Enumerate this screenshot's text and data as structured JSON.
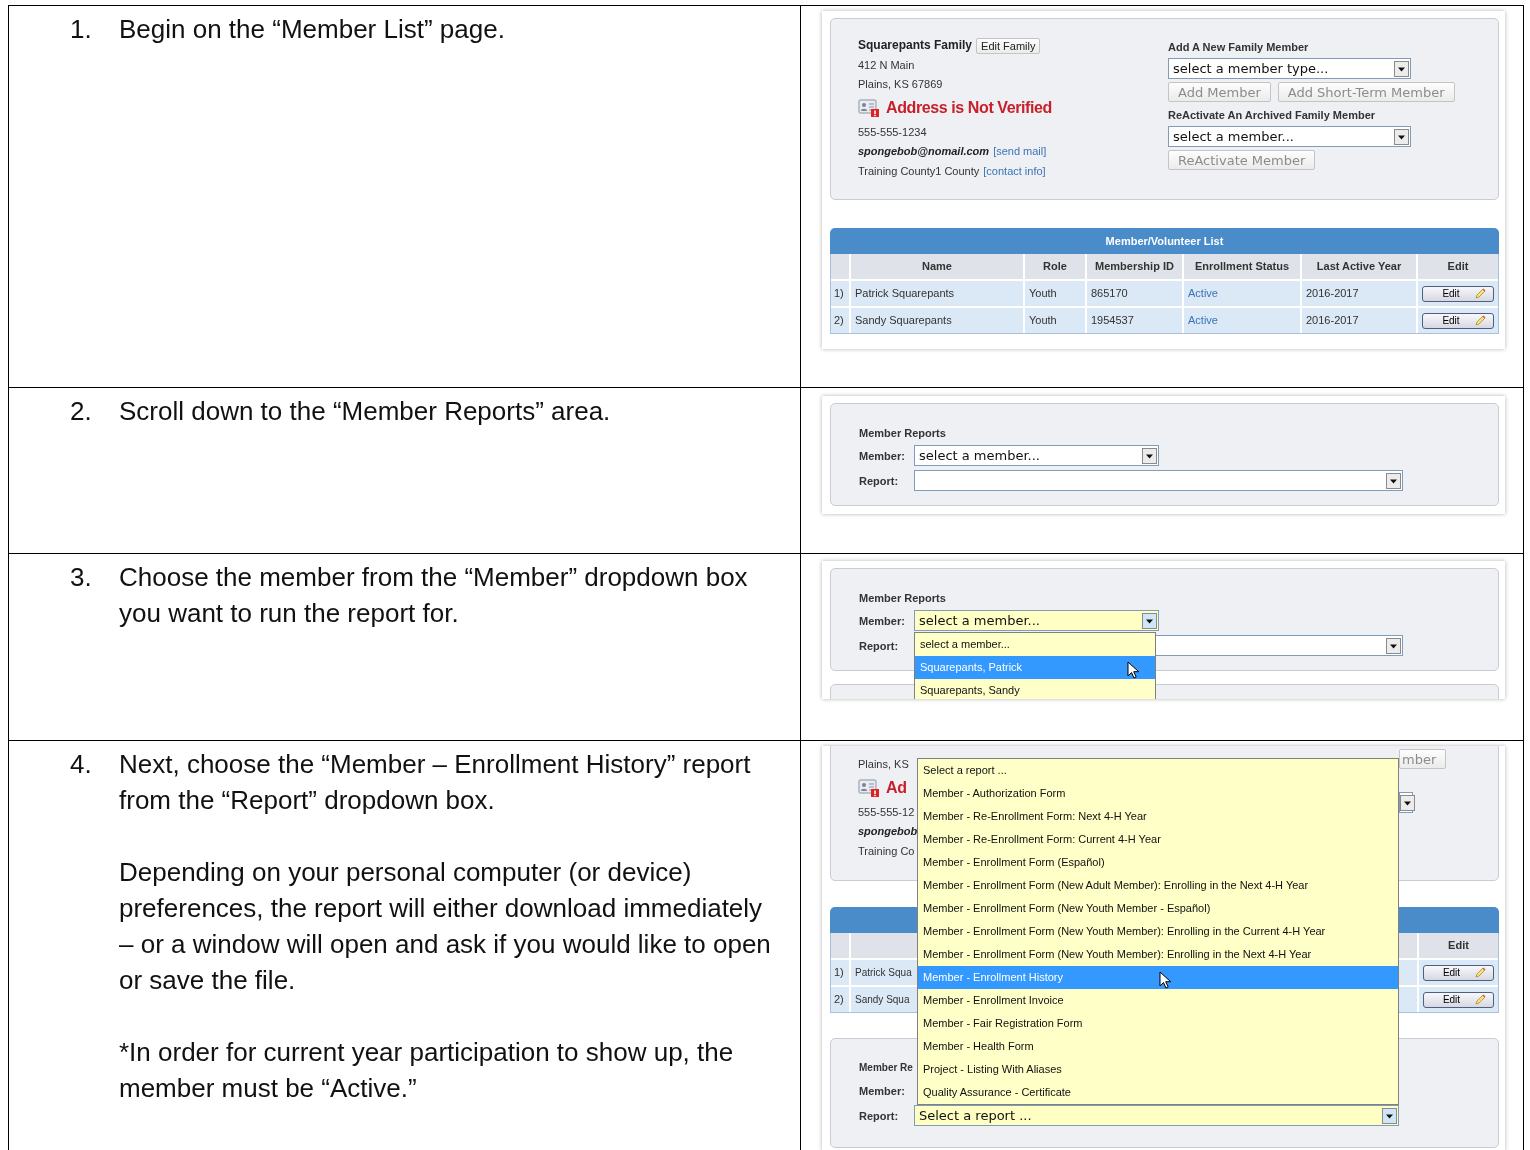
{
  "steps": [
    {
      "number": "1.",
      "paragraphs": [
        "Begin on the “Member List” page."
      ],
      "screenshot": {
        "kind": "member-list",
        "family": {
          "name": "Squarepants Family",
          "edit_button": {
            "label": "Edit Family",
            "disabled": false
          },
          "address_lines": [
            "412 N Main",
            "Plains, KS 67869"
          ],
          "warning": "Address is Not Verified",
          "phone": "555-555-1234",
          "email": "spongebob@nomail.com",
          "email_link": "[send mail]",
          "county": "Training County1 County",
          "county_link": "[contact info]"
        },
        "add_member": {
          "heading": "Add A New Family Member",
          "select": {
            "value": "select a member type...",
            "focused": false
          },
          "buttons": [
            {
              "label": "Add Member",
              "disabled": true
            },
            {
              "label": "Add Short-Term Member",
              "disabled": true
            }
          ],
          "reactivate_heading": "ReActivate An Archived Family Member",
          "reactivate_select": {
            "value": "select a member...",
            "focused": false
          },
          "reactivate_button": {
            "label": "ReActivate Member",
            "disabled": true
          }
        },
        "table": {
          "title": "Member/Volunteer List",
          "columns": [
            "Name",
            "Role",
            "Membership ID",
            "Enrollment Status",
            "Last Active Year",
            "Edit"
          ],
          "rows": [
            {
              "index": "1)",
              "cells": [
                "Patrick Squarepants",
                "Youth",
                "865170",
                "Active",
                "2016-2017"
              ],
              "edit": "Edit"
            },
            {
              "index": "2)",
              "cells": [
                "Sandy Squarepants",
                "Youth",
                "1954537",
                "Active",
                "2016-2017"
              ],
              "edit": "Edit"
            }
          ]
        }
      }
    },
    {
      "number": "2.",
      "paragraphs": [
        "Scroll down to the “Member Reports” area."
      ],
      "screenshot": {
        "kind": "member-reports",
        "reports": {
          "heading": "Member Reports",
          "member_label": "Member:",
          "member_select": {
            "value": "select a member...",
            "focused": false
          },
          "report_label": "Report:",
          "report_select": {
            "focused": false
          }
        }
      }
    },
    {
      "number": "3.",
      "paragraphs": [
        "Choose the member from the “Member” dropdown box you want to run the report for."
      ],
      "screenshot": {
        "kind": "member-dropdown",
        "reports": {
          "heading": "Member Reports",
          "member_label": "Member:",
          "member_select": {
            "value": "select a member...",
            "focused": true
          },
          "report_label": "Report:",
          "report_select": {
            "focused": false
          }
        },
        "options": [
          {
            "label": "select a member...",
            "selected": false
          },
          {
            "label": "Squarepants, Patrick",
            "selected": true
          },
          {
            "label": "Squarepants, Sandy",
            "selected": false
          }
        ]
      }
    },
    {
      "number": "4.",
      "paragraphs": [
        "Next, choose the “Member – Enrollment History” report from the “Report” dropdown box.",
        "Depending on your personal computer (or device) preferences, the report will either download immediately – or a window will open and ask if you would like to open or save the file.",
        "*In order for current year participation to show up, the member must be “Active.”"
      ],
      "screenshot": {
        "kind": "report-dropdown",
        "family": {
          "address_line": "Plains, KS",
          "warning": "Ad",
          "phone": "555-555-12",
          "email": "spongebob",
          "county": "Training Co"
        },
        "add_button": {
          "label": "mber",
          "disabled": true
        },
        "table": {
          "columns": [
            "Edit"
          ],
          "rows": [
            {
              "index": "1)",
              "name": "Patrick Squa",
              "edit": "Edit"
            },
            {
              "index": "2)",
              "name": "Sandy Squa",
              "edit": "Edit"
            }
          ]
        },
        "reports": {
          "heading": "Member Re",
          "member_label": "Member:",
          "report_label": "Report:",
          "report_select": {
            "value": "Select a report ...",
            "focused": true
          }
        },
        "options": [
          {
            "label": "Select a report ...",
            "selected": false
          },
          {
            "label": "Member - Authorization Form",
            "selected": false
          },
          {
            "label": "Member - Re-Enrollment Form: Next 4-H Year",
            "selected": false
          },
          {
            "label": "Member - Re-Enrollment Form: Current 4-H Year",
            "selected": false
          },
          {
            "label": "Member - Enrollment Form (Español)",
            "selected": false
          },
          {
            "label": "Member - Enrollment Form (New Adult Member): Enrolling in the Next 4-H Year",
            "selected": false
          },
          {
            "label": "Member - Enrollment Form (New Youth Member - Español)",
            "selected": false
          },
          {
            "label": "Member - Enrollment Form (New Youth Member): Enrolling in the Current 4-H Year",
            "selected": false
          },
          {
            "label": "Member - Enrollment Form (New Youth Member): Enrolling in the Next 4-H Year",
            "selected": false
          },
          {
            "label": "Member - Enrollment History",
            "selected": true
          },
          {
            "label": "Member - Enrollment Invoice",
            "selected": false
          },
          {
            "label": "Member - Fair Registration Form",
            "selected": false
          },
          {
            "label": "Member - Health Form",
            "selected": false
          },
          {
            "label": "Project - Listing With Aliases",
            "selected": false
          },
          {
            "label": "Quality Assurance - Certificate",
            "selected": false
          }
        ]
      }
    }
  ]
}
